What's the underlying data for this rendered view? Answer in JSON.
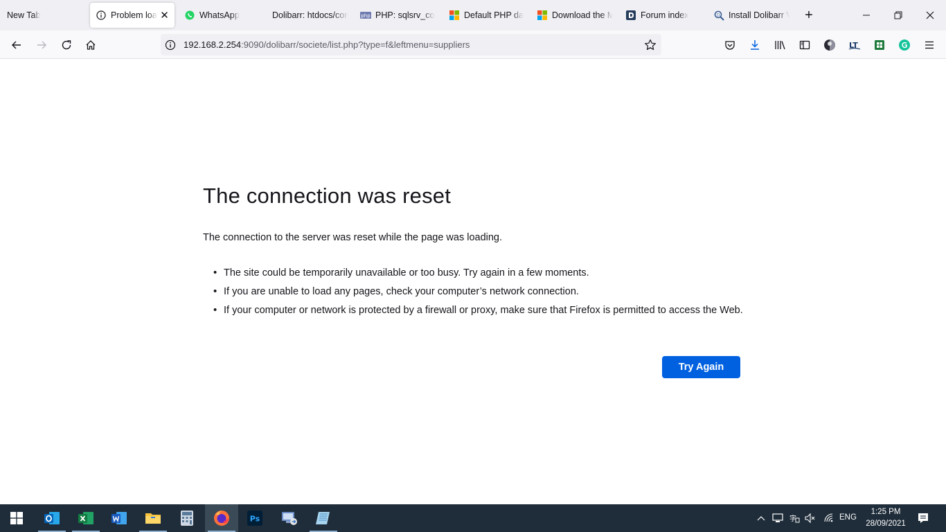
{
  "tabs": [
    {
      "label": "New Tab",
      "icon": "none"
    },
    {
      "label": "Problem loading page",
      "icon": "info-icon",
      "active": true
    },
    {
      "label": "WhatsApp",
      "icon": "whatsapp-icon"
    },
    {
      "label": "Dolibarr: htdocs/core",
      "icon": "none"
    },
    {
      "label": "PHP: sqlsrv_connect",
      "icon": "php-icon"
    },
    {
      "label": "Default PHP data",
      "icon": "microsoft-icon"
    },
    {
      "label": "Download the Microsoft",
      "icon": "microsoft-icon"
    },
    {
      "label": "Forum index",
      "icon": "dolibarr-icon"
    },
    {
      "label": "Install Dolibarr V",
      "icon": "search-doc-icon"
    }
  ],
  "urlbar": {
    "host": "192.168.2.254",
    "rest": ":9090/dolibarr/societe/list.php?type=f&leftmenu=suppliers"
  },
  "error": {
    "title": "The connection was reset",
    "description": "The connection to the server was reset while the page was loading.",
    "items": [
      "The site could be temporarily unavailable or too busy. Try again in a few moments.",
      "If you are unable to load any pages, check your computer’s network connection.",
      "If your computer or network is protected by a firewall or proxy, make sure that Firefox is permitted to access the Web."
    ],
    "button": "Try Again"
  },
  "taskbar": {
    "apps": [
      "start",
      "outlook",
      "excel",
      "word",
      "file-explorer",
      "calculator",
      "firefox",
      "photoshop",
      "remote-desktop",
      "notepad"
    ],
    "lang": "ENG",
    "time": "1:25 PM",
    "date": "28/09/2021"
  },
  "colors": {
    "accent": "#0061e0",
    "taskbar": "#1f2d3a"
  }
}
